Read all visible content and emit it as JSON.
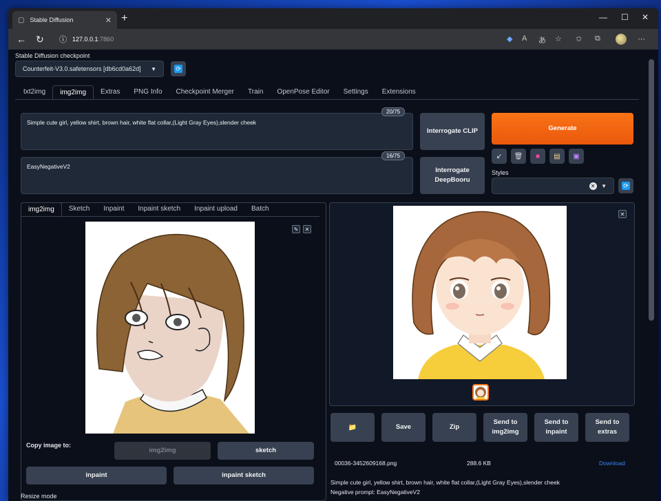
{
  "browser": {
    "tab_title": "Stable Diffusion",
    "new_tab": "+",
    "url_host": "127.0.0.1",
    "url_port": ":7860"
  },
  "checkpoint": {
    "label": "Stable Diffusion checkpoint",
    "value": "Counterfeit-V3.0.safetensors [db6cd0a62d]"
  },
  "main_tabs": [
    "txt2img",
    "img2img",
    "Extras",
    "PNG Info",
    "Checkpoint Merger",
    "Train",
    "OpenPose Editor",
    "Settings",
    "Extensions"
  ],
  "prompt": {
    "positive": "Simple cute girl, yellow shirt, brown hair, white flat collar,(Light Gray Eyes),slender cheek",
    "positive_count": "20/75",
    "negative": "EasyNegativeV2",
    "negative_count": "16/75"
  },
  "buttons": {
    "interrogate_clip": "Interrogate CLIP",
    "interrogate_deepbooru": "Interrogate DeepBooru",
    "generate": "Generate"
  },
  "styles": {
    "label": "Styles"
  },
  "sub_tabs": [
    "img2img",
    "Sketch",
    "Inpaint",
    "Inpaint sketch",
    "Inpaint upload",
    "Batch"
  ],
  "copy_image": {
    "label": "Copy image to:",
    "img2img": "img2img",
    "sketch": "sketch",
    "inpaint": "inpaint",
    "inpaint_sketch": "inpaint sketch"
  },
  "resize_mode": "Resize mode",
  "output_actions": {
    "folder": "📁",
    "save": "Save",
    "zip": "Zip",
    "send_img2img": "Send to img2img",
    "send_inpaint": "Send to inpaint",
    "send_extras": "Send to extras"
  },
  "output_file": {
    "name": "00036-3452609168.png",
    "size": "288.6 KB",
    "download": "Download"
  },
  "output_info": {
    "prompt": "Simple cute girl, yellow shirt, brown hair, white flat collar,(Light Gray Eyes),slender cheek",
    "negative": "Negative prompt: EasyNegativeV2"
  },
  "colors": {
    "accent": "#f97316",
    "background": "#0b0f19",
    "panel": "#1f2937"
  }
}
